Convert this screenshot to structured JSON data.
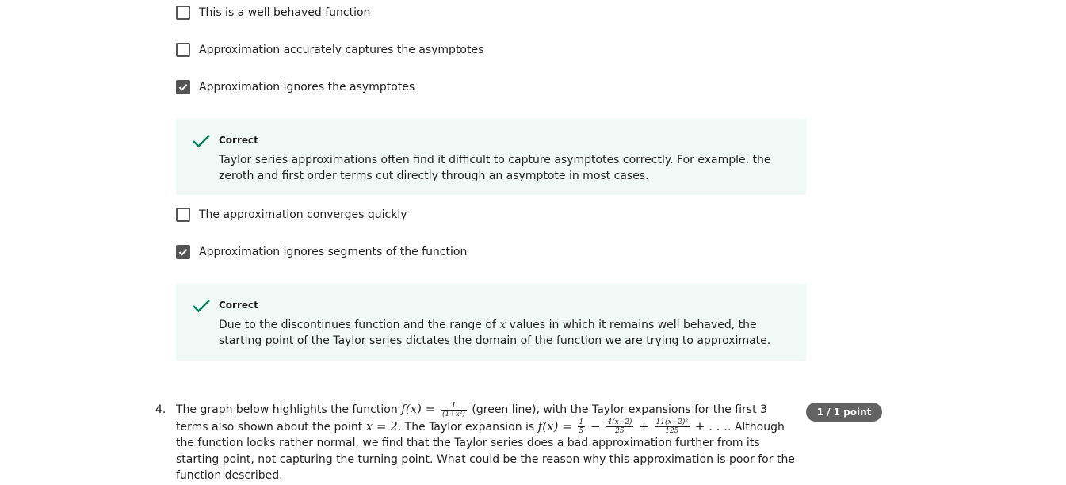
{
  "options": [
    {
      "label": "This is a well behaved function",
      "checked": false
    },
    {
      "label": "Approximation accurately captures the asymptotes",
      "checked": false
    },
    {
      "label": "Approximation ignores the asymptotes",
      "checked": true
    },
    {
      "label": "The approximation converges quickly",
      "checked": false
    },
    {
      "label": "Approximation ignores segments of the function",
      "checked": true
    }
  ],
  "feedback": [
    {
      "title": "Correct",
      "body": "Taylor series approximations often find it difficult to capture asymptotes correctly. For example, the zeroth and first order terms cut directly through an asymptote in most cases."
    },
    {
      "title": "Correct",
      "body_pre": "Due to the discontinues function and the range of ",
      "body_math": "x",
      "body_post": " values in which it remains well behaved, the starting point of the Taylor series dictates the domain of the function we are trying to approximate."
    }
  ],
  "question": {
    "number": "4.",
    "t1": "The graph below highlights the function ",
    "f_lhs": "f(x) = ",
    "f_num": "1",
    "f_den": "(1+x²)",
    "t2": " (green line), with the Taylor expansions for the first 3 terms also shown about the point ",
    "point": "x = 2",
    "t3": ". The Taylor expansion is ",
    "exp_lhs": "f(x) = ",
    "e1_num": "1",
    "e1_den": "5",
    "minus": " − ",
    "e2_num": "4(x−2)",
    "e2_den": "25",
    "plus1": " + ",
    "e3_num": "11(x−2)²",
    "e3_den": "125",
    "plus2": " + . . .",
    "t4": ". Although the function looks rather normal, we find that the Taylor series does a bad approximation further from its starting point, not capturing the turning point. What could be the reason why this approximation is poor for the function described.",
    "points": "1 / 1 point"
  },
  "colors": {
    "correct_green": "#0a7f5b",
    "feedback_bg": "#f0f9f6",
    "badge_bg": "#636363"
  },
  "icons": {
    "checkbox_checked": "checkmark-icon",
    "feedback": "check-icon"
  }
}
